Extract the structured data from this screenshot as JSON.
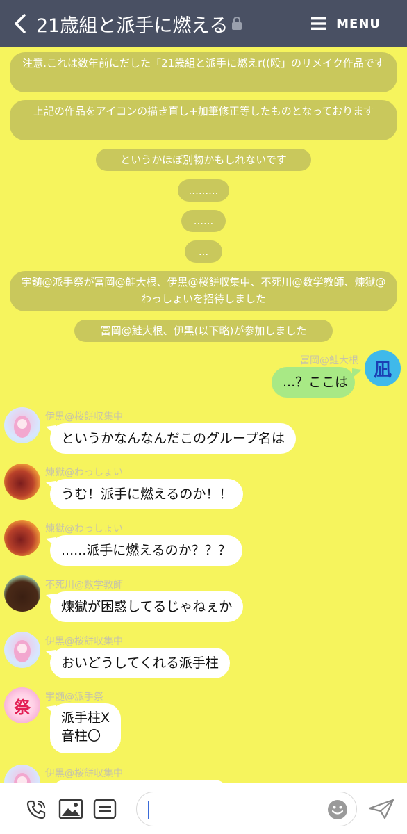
{
  "header": {
    "title": "21歳組と派手に燃える",
    "menu_label": "MENU"
  },
  "system_messages": [
    "注意.これは数年前にだした「21歳組と派手に燃えr((殴」のリメイク作品です",
    "上記の作品をアイコンの描き直し+加筆修正等したものとなっております",
    "というかほぼ別物かもしれないです",
    ".........",
    "......",
    "...",
    "宇髄@派手祭が冨岡@鮭大根、伊黒@桜餅収集中、不死川@数学教師、煉獄@わっしょいを招待しました",
    "冨岡@鮭大根、伊黒(以下略)が参加しました"
  ],
  "messages": [
    {
      "sender": "冨岡@鮭大根",
      "text": "...？ここは",
      "avatar_text": "凪"
    },
    {
      "sender": "伊黒@桜餅収集中",
      "text": "というかなんなんだこのグループ名は"
    },
    {
      "sender": "煉獄@わっしょい",
      "text": "うむ！派手に燃えるのか！！"
    },
    {
      "sender": "煉獄@わっしょい",
      "text": "......派手に燃えるのか？？？"
    },
    {
      "sender": "不死川@数学教師",
      "text": "煉獄が困惑してるじゃねぇか"
    },
    {
      "sender": "伊黒@桜餅収集中",
      "text": "おいどうしてくれる派手柱"
    },
    {
      "sender": "宇髄@派手祭",
      "text_line1": "派手柱X",
      "text_line2": "音柱〇",
      "avatar_text": "祭"
    },
    {
      "sender": "伊黒@桜餅収集中"
    }
  ],
  "colors": {
    "background": "#f6f45d",
    "header": "#495063",
    "system_bubble": "#c9c85c",
    "my_bubble": "#a8e985",
    "other_bubble": "#ffffff"
  },
  "icons": [
    "back-icon",
    "lock-icon",
    "menu-icon",
    "phone-icon",
    "image-icon",
    "keyboard-icon",
    "emoji-icon",
    "send-icon"
  ]
}
